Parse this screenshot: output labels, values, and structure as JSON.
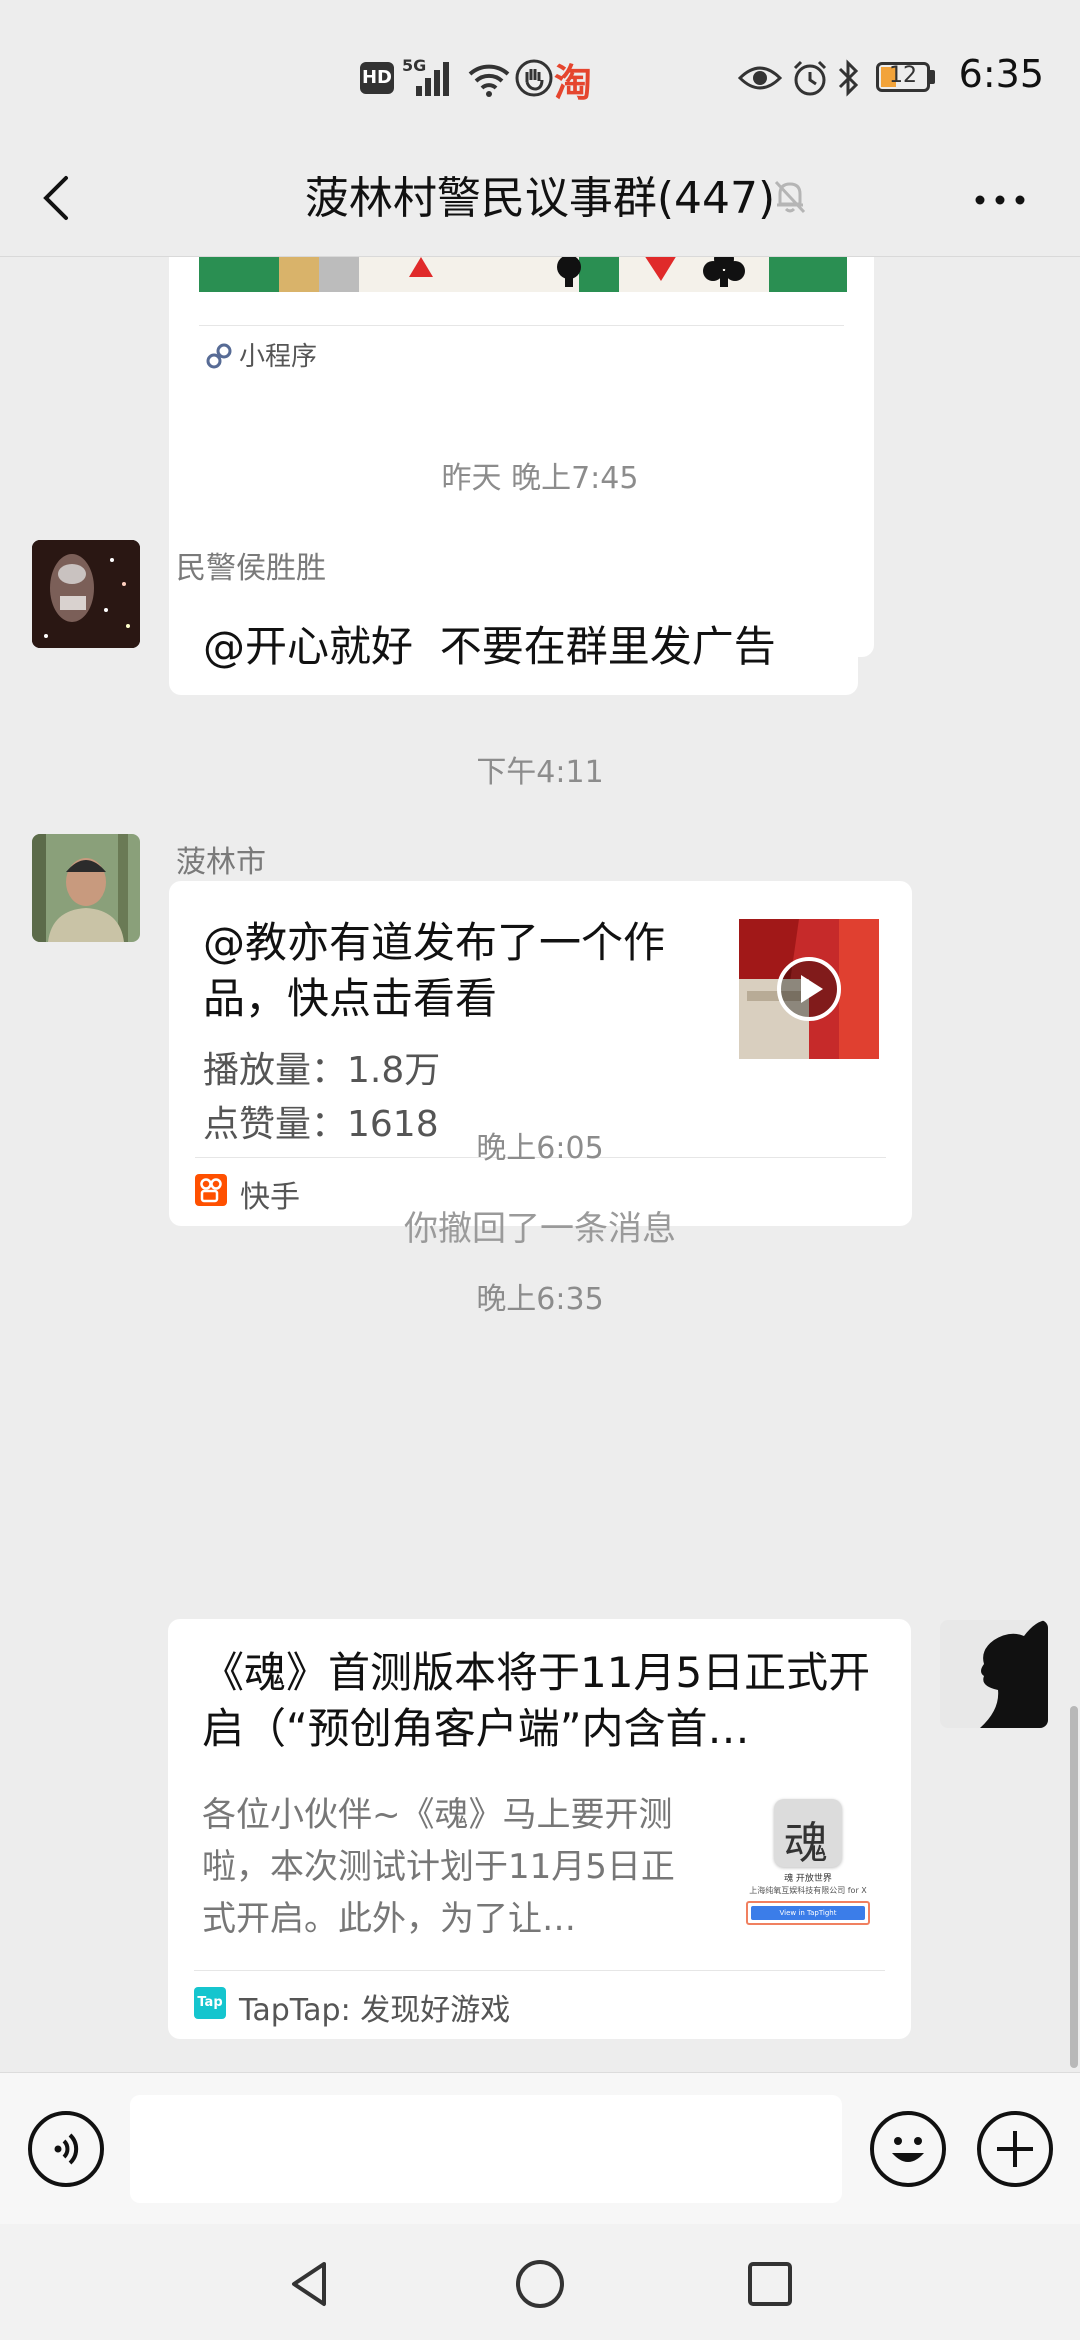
{
  "status_bar": {
    "hd": "HD",
    "net": "5G",
    "taobao": "淘",
    "battery": "12",
    "time": "6:35"
  },
  "header": {
    "title": "菠林村警民议事群(447)"
  },
  "chat": {
    "mini_program_label": "小程序",
    "sep1": "昨天 晚上7:45",
    "msg1": {
      "sender": "民警侯胜胜",
      "text": "@开心就好  不要在群里发广告"
    },
    "sep2": "下午4:11",
    "msg2": {
      "sender": "菠林市",
      "text": "@教亦有道发布了一个作品，快点击看看",
      "plays": "播放量：1.8万",
      "likes": "点赞量：1618",
      "source": "快手"
    },
    "sep3": "晚上6:05",
    "recall": "你撤回了一条消息",
    "sep4": "晚上6:35",
    "msg3": {
      "title": "《魂》首测版本将于11月5日正式开启（“预创角客户端”内含首…",
      "desc": "各位小伙伴~《魂》马上要开测啦，本次测试计划于11月5日正式开启。此外，为了让…",
      "thumb_char": "魂",
      "thumb_caption": "魂 开放世界",
      "thumb_company": "上海纯氧互娱科技有限公司 for X",
      "thumb_button": "View in TapTight",
      "source": "TapTap: 发现好游戏",
      "tap_logo": "Tap"
    }
  },
  "colors": {
    "background": "#ededed",
    "bubble": "#ffffff",
    "kuaishou": "#ff5000",
    "taptap": "#15c5ce",
    "mini_program": "#576b95"
  }
}
